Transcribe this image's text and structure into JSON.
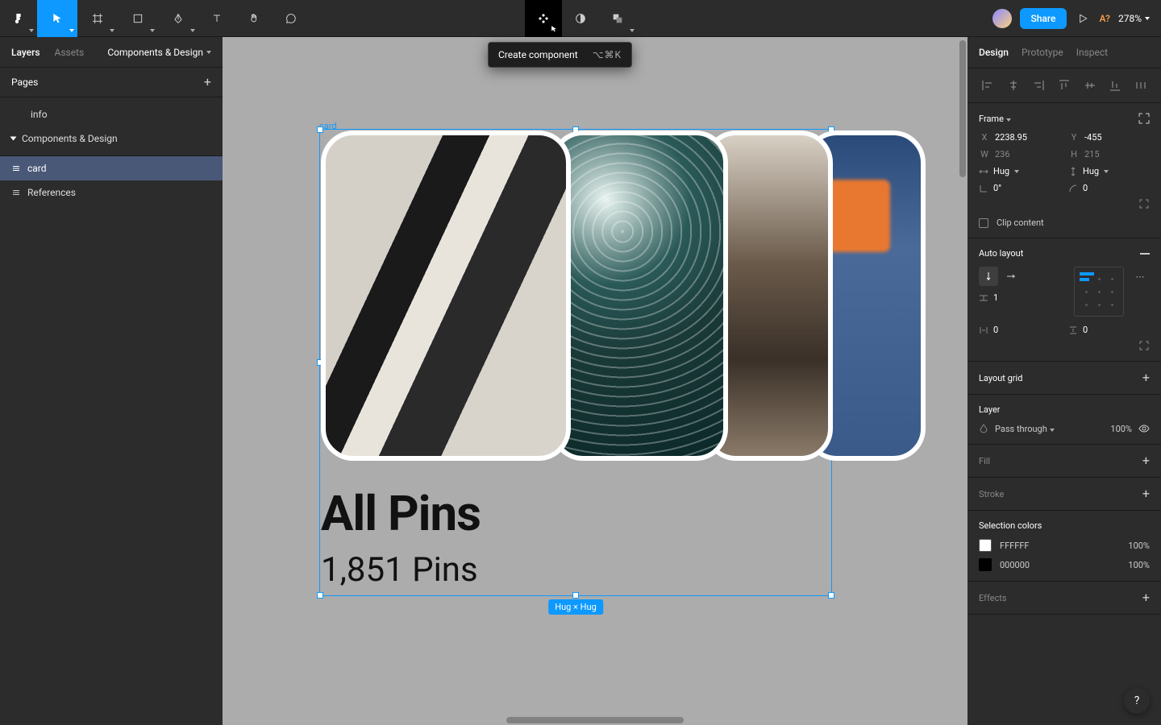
{
  "toolbar": {
    "tooltip": {
      "label": "Create component",
      "shortcut": "⌥⌘K"
    },
    "share": "Share",
    "aq": "A?",
    "zoom": "278%"
  },
  "left": {
    "tabs": {
      "layers": "Layers",
      "assets": "Assets"
    },
    "file": "Components & Design",
    "pages_header": "Pages",
    "pages": {
      "info": "info",
      "current": "Components & Design"
    },
    "layers": {
      "card": "card",
      "references": "References"
    }
  },
  "canvas": {
    "frame_label": "card",
    "dim_badge": "Hug × Hug",
    "card": {
      "title": "All Pins",
      "subtitle": "1,851 Pins"
    }
  },
  "right": {
    "tabs": {
      "design": "Design",
      "prototype": "Prototype",
      "inspect": "Inspect"
    },
    "frame": {
      "header": "Frame",
      "x": "2238.95",
      "y": "-455",
      "w": "236",
      "h": "215",
      "hug1": "Hug",
      "hug2": "Hug",
      "rotation": "0°",
      "radius": "0",
      "clip": "Clip content"
    },
    "autolayout": {
      "header": "Auto layout",
      "spacing": "1",
      "pad_h": "0",
      "pad_v": "0"
    },
    "layoutgrid": "Layout grid",
    "layer": {
      "header": "Layer",
      "blend": "Pass through",
      "opacity": "100%"
    },
    "fill": "Fill",
    "stroke": "Stroke",
    "selcolors": {
      "header": "Selection colors",
      "c1": "FFFFFF",
      "c2": "000000",
      "pct": "100%"
    },
    "effects": "Effects"
  },
  "help": "?"
}
